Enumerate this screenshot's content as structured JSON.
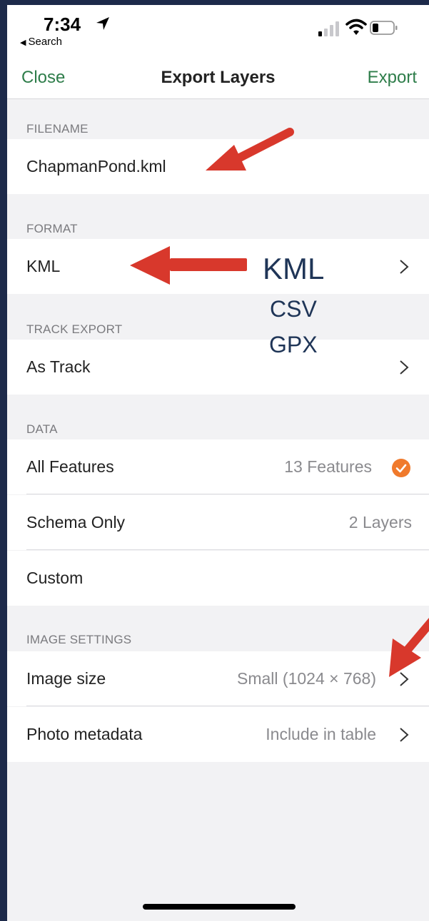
{
  "status": {
    "time": "7:34",
    "back_app": "Search",
    "icons": [
      "location-arrow-icon",
      "cellular-signal-icon",
      "wifi-icon",
      "battery-icon"
    ]
  },
  "nav": {
    "close_label": "Close",
    "title": "Export Layers",
    "export_label": "Export"
  },
  "sections": {
    "filename": {
      "header": "FILENAME",
      "value": "ChapmanPond.kml"
    },
    "format": {
      "header": "FORMAT",
      "value": "KML"
    },
    "track_export": {
      "header": "TRACK EXPORT",
      "value": "As Track"
    },
    "data": {
      "header": "DATA",
      "rows": [
        {
          "label": "All Features",
          "value": "13 Features",
          "selected": true
        },
        {
          "label": "Schema Only",
          "value": "2 Layers",
          "selected": false
        },
        {
          "label": "Custom",
          "value": "",
          "selected": false
        }
      ]
    },
    "image_settings": {
      "header": "IMAGE SETTINGS",
      "rows": [
        {
          "label": "Image size",
          "value": "Small (1024 × 768)"
        },
        {
          "label": "Photo metadata",
          "value": "Include in table"
        }
      ]
    }
  },
  "annotation": {
    "formats": [
      "KML",
      "CSV",
      "GPX"
    ],
    "text_color": "#1f3557",
    "arrow_color": "#d8382c"
  },
  "colors": {
    "accent": "#2e7d4a",
    "check": "#f07a2c",
    "background": "#f2f2f4"
  }
}
